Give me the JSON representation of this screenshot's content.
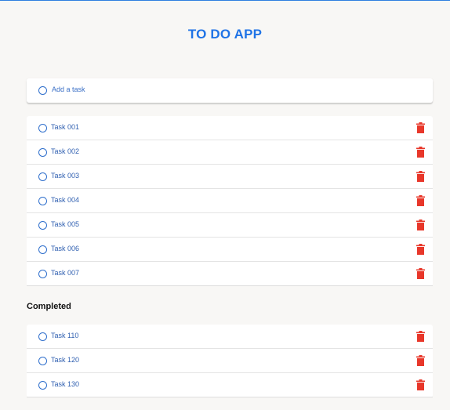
{
  "app": {
    "title": "TO DO APP",
    "accent_color": "#1f73e6",
    "delete_color": "#e8372a"
  },
  "add_task": {
    "placeholder": "Add a task"
  },
  "tasks": [
    {
      "label": "Task 001"
    },
    {
      "label": "Task 002"
    },
    {
      "label": "Task 003"
    },
    {
      "label": "Task 004"
    },
    {
      "label": "Task 005"
    },
    {
      "label": "Task 006"
    },
    {
      "label": "Task 007"
    }
  ],
  "completed": {
    "heading": "Completed",
    "tasks": [
      {
        "label": "Task 110"
      },
      {
        "label": "Task 120"
      },
      {
        "label": "Task 130"
      }
    ]
  },
  "icons": {
    "radio": "circle-icon",
    "delete": "trash-icon"
  }
}
